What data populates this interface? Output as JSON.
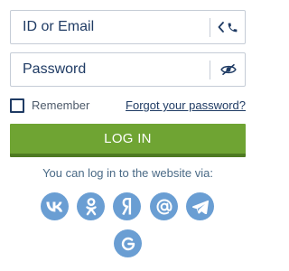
{
  "login_form": {
    "login_placeholder": "ID or Email",
    "password_placeholder": "Password",
    "remember_label": "Remember",
    "forgot_link": "Forgot your password?",
    "submit_label": "LOG IN",
    "via_text": "You can log in to the website via:",
    "login_field_icons": [
      "chevron-left-icon",
      "phone-icon"
    ],
    "password_field_icon": "eye-slash-icon",
    "remember_checked": false
  },
  "social_providers": [
    "vk",
    "odnoklassniki",
    "yandex",
    "mail",
    "telegram",
    "google"
  ],
  "colors": {
    "primary_text": "#1f3b64",
    "login_button": "#6fa433",
    "login_button_shadow": "#4e7a22",
    "social_icon_bg": "#6a9ed3",
    "input_border": "#c5ccd6"
  }
}
